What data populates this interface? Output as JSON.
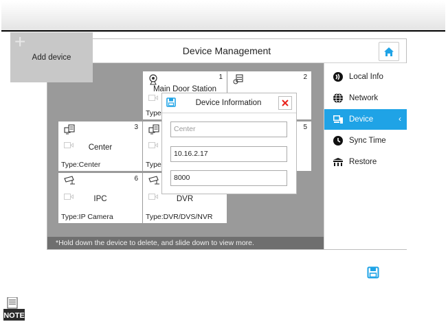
{
  "window": {
    "title": "Device Management"
  },
  "tiles": {
    "add_device": "Add device",
    "main_door": {
      "number": "1",
      "name": "Main Door Station",
      "type": "Type"
    },
    "tile2": {
      "number": "2"
    },
    "center": {
      "number": "3",
      "name": "Center",
      "type": "Type:Center"
    },
    "tile4": {
      "type": "Type"
    },
    "tile5": {
      "number": "5"
    },
    "ipc": {
      "number": "6",
      "name": "IPC",
      "type": "Type:IP Camera"
    },
    "dvr": {
      "name": "DVR",
      "type": "Type:DVR/DVS/NVR"
    }
  },
  "dialog": {
    "title": "Device Information",
    "name_placeholder": "Center",
    "ip_value": "10.16.2.17",
    "port_value": "8000"
  },
  "status_hint": "*Hold down the device to delete, and slide down to view more.",
  "sidebar": {
    "items": [
      {
        "label": "Local Info",
        "icon": "local-info-icon"
      },
      {
        "label": "Network",
        "icon": "globe-icon"
      },
      {
        "label": "Device",
        "icon": "device-icon",
        "active": true
      },
      {
        "label": "Sync Time",
        "icon": "clock-icon"
      },
      {
        "label": "Restore",
        "icon": "restore-icon"
      }
    ]
  },
  "note": {
    "label": "NOTE"
  },
  "colors": {
    "accent": "#1fa3e6",
    "close": "#e8211b",
    "grid_bg": "#9a9a9a"
  }
}
